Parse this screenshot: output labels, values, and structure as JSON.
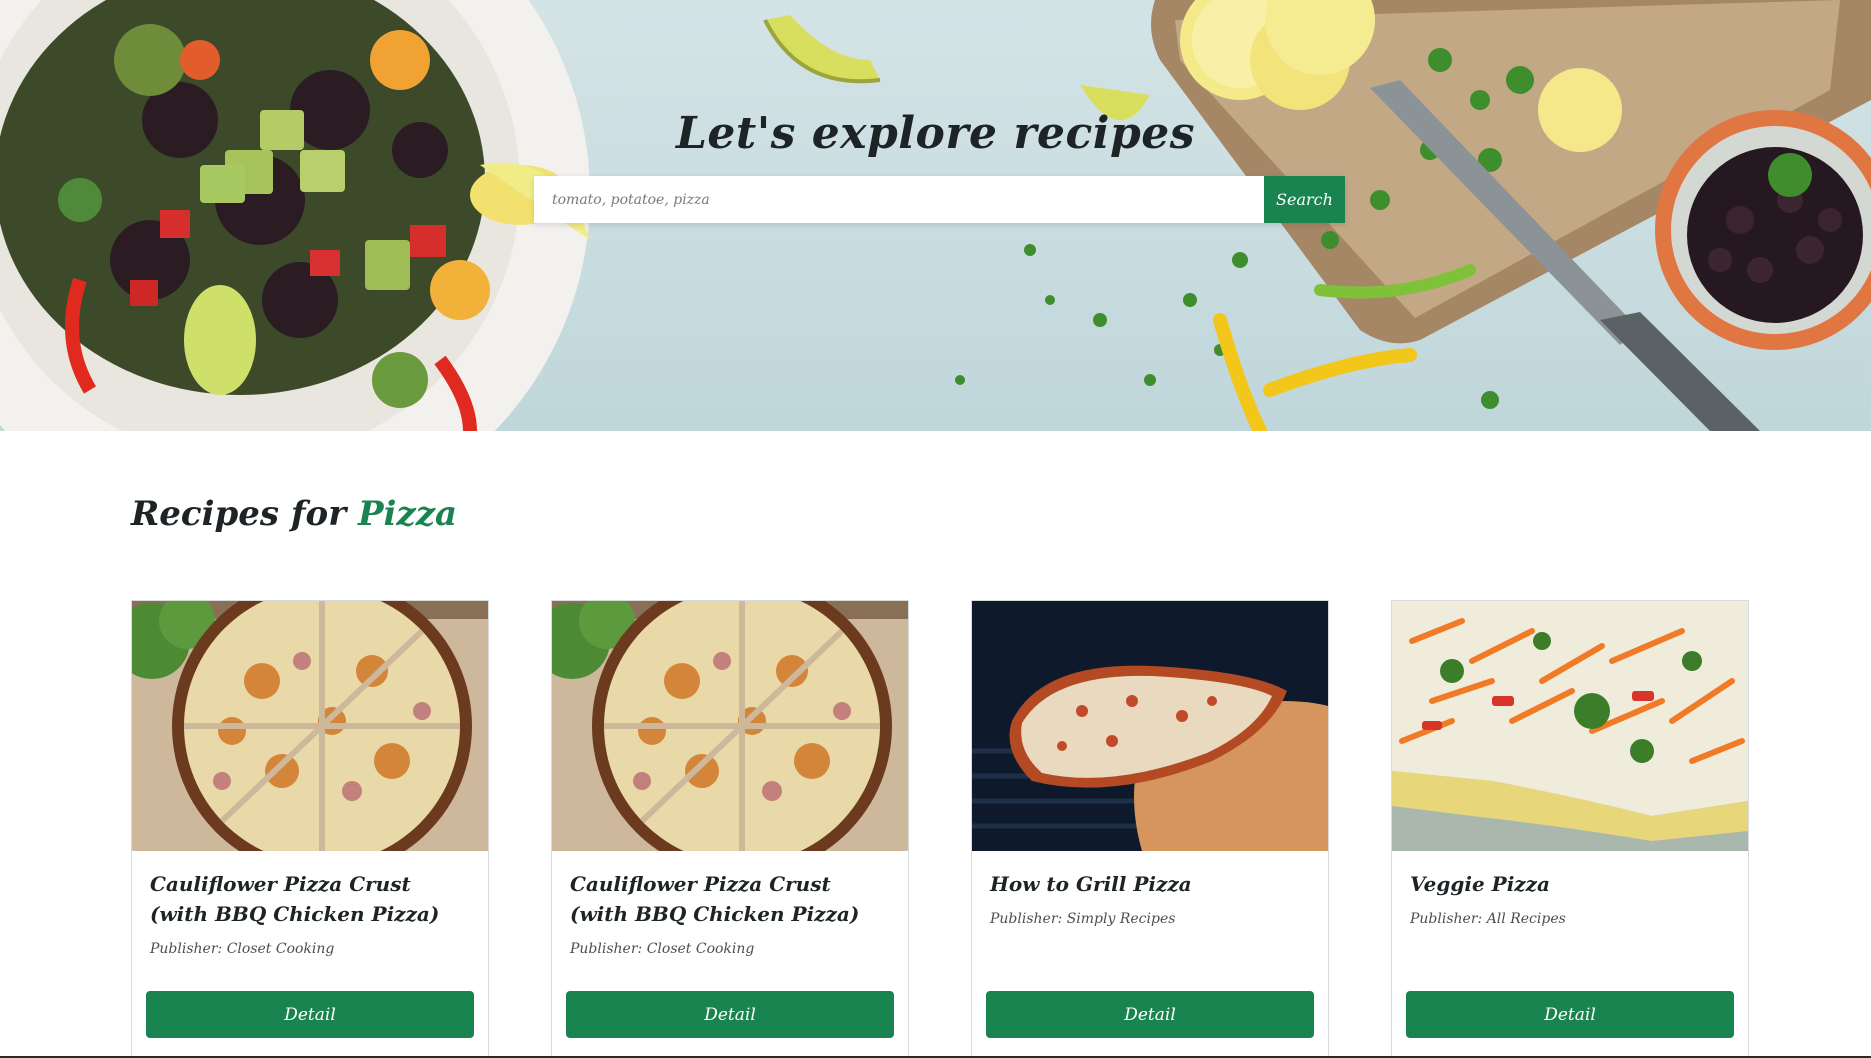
{
  "hero": {
    "title": "Let's explore recipes",
    "search": {
      "placeholder": "tomato, potatoe, pizza",
      "value": "",
      "button_label": "Search"
    }
  },
  "results": {
    "heading_prefix": "Recipes for",
    "query": "Pizza"
  },
  "recipes": [
    {
      "title": "Cauliflower Pizza Crust (with BBQ Chicken Pizza)",
      "publisher": "Publisher: Closet Cooking",
      "button_label": "Detail",
      "image": "cauliflower-pizza-photo"
    },
    {
      "title": "Cauliflower Pizza Crust (with BBQ Chicken Pizza)",
      "publisher": "Publisher: Closet Cooking",
      "button_label": "Detail",
      "image": "cauliflower-pizza-photo"
    },
    {
      "title": "How to Grill Pizza",
      "publisher": "Publisher: Simply Recipes",
      "button_label": "Detail",
      "image": "grilled-pizza-photo"
    },
    {
      "title": "Veggie Pizza",
      "publisher": "Publisher: All Recipes",
      "button_label": "Detail",
      "image": "veggie-pizza-photo"
    }
  ],
  "colors": {
    "accent": "#1a8451",
    "text": "#1e2426",
    "hero_bg": "#c9dde0"
  }
}
